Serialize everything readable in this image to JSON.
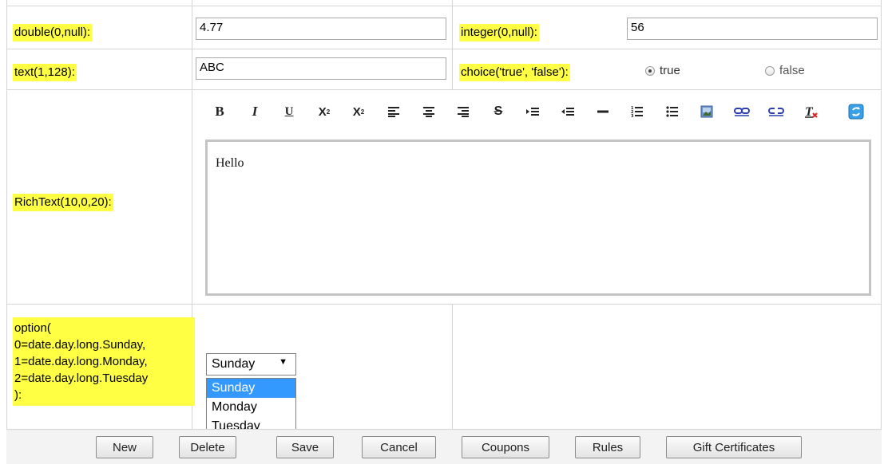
{
  "fields": {
    "double": {
      "label": "double(0,null):",
      "value": "4.77"
    },
    "integer": {
      "label": "integer(0,null):",
      "value": "56"
    },
    "text": {
      "label": "text(1,128):",
      "value": "ABC"
    },
    "choice": {
      "label": "choice('true', 'false'):",
      "options": [
        "true",
        "false"
      ],
      "selected": "true"
    },
    "richtext": {
      "label": "RichText(10,0,20):",
      "content": "Hello"
    },
    "option": {
      "label_lines": [
        "option(",
        "0=date.day.long.Sunday,",
        "1=date.day.long.Monday,",
        "2=date.day.long.Tuesday",
        "):"
      ],
      "selected": "Sunday",
      "options": [
        "Sunday",
        "Monday",
        "Tuesday"
      ]
    }
  },
  "toolbar": {
    "buttons": [
      "bold-icon",
      "italic-icon",
      "underline-icon",
      "subscript-icon",
      "superscript-icon",
      "align-left-icon",
      "align-center-icon",
      "align-right-icon",
      "strikethrough-icon",
      "indent-icon",
      "outdent-icon",
      "horizontal-rule-icon",
      "ordered-list-icon",
      "unordered-list-icon",
      "image-icon",
      "link-icon",
      "unlink-icon",
      "remove-format-icon",
      "source-toggle-icon"
    ]
  },
  "buttons": {
    "new": "New",
    "delete": "Delete",
    "save": "Save",
    "cancel": "Cancel",
    "coupons": "Coupons",
    "rules": "Rules",
    "gift": "Gift Certificates"
  },
  "colors": {
    "label_highlight": "#ffff44",
    "selection": "#3399ff"
  }
}
